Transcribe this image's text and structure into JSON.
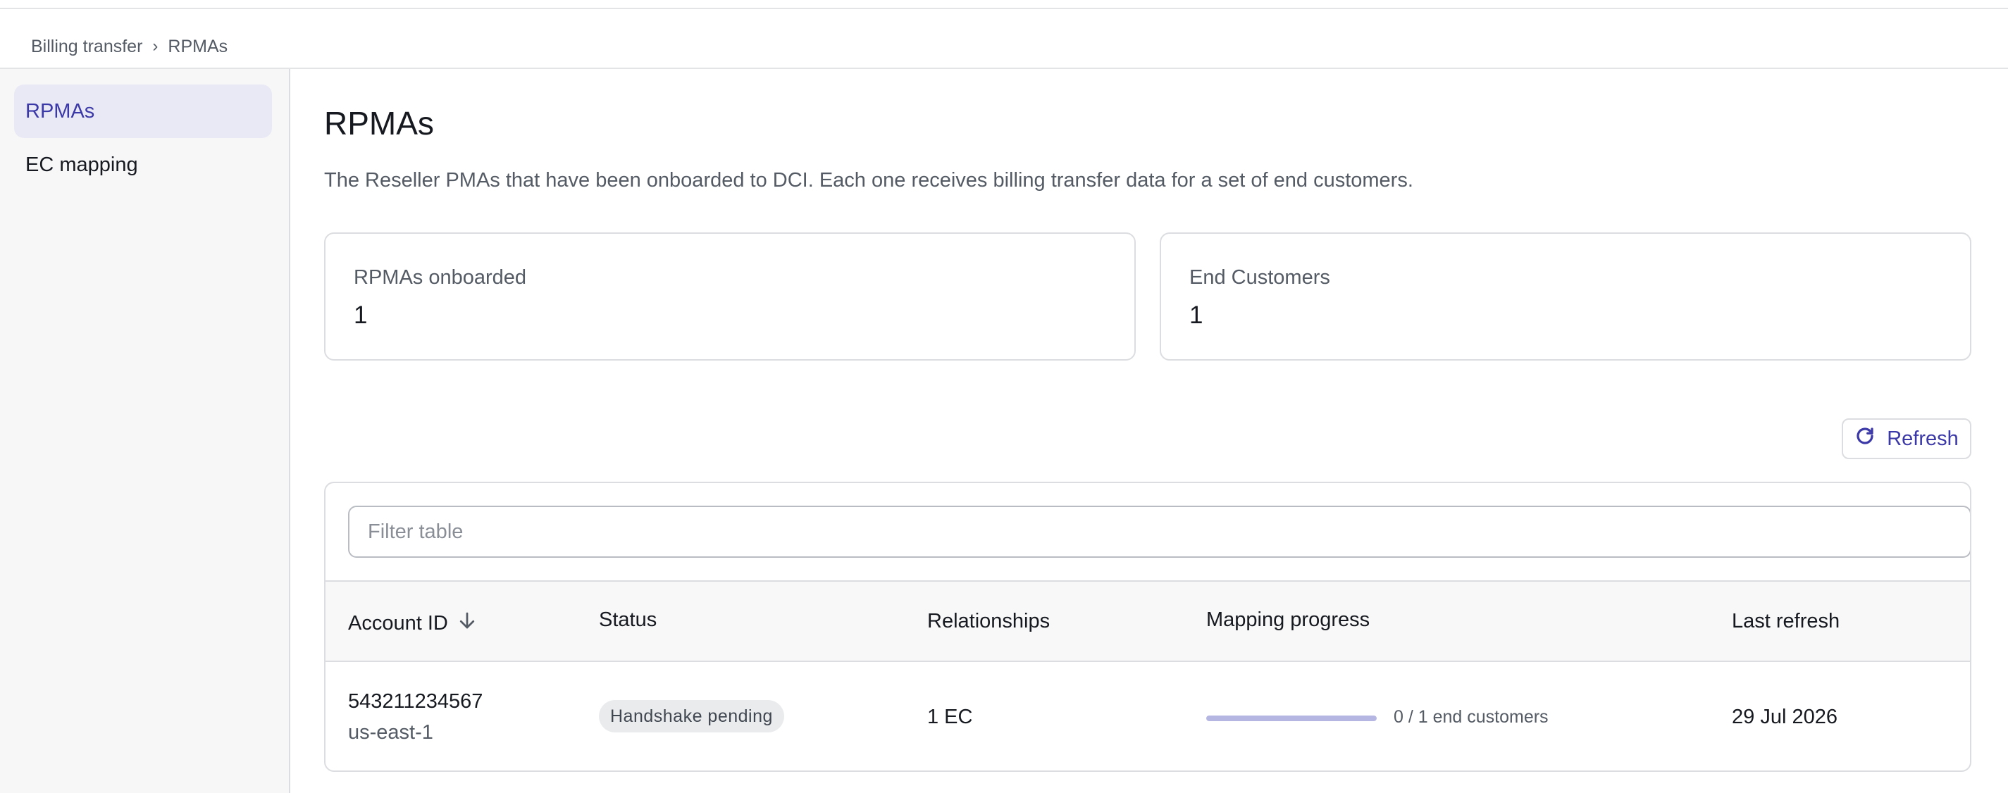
{
  "breadcrumb": {
    "parent": "Billing transfer",
    "separator": "›",
    "current": "RPMAs"
  },
  "sidebar": {
    "items": [
      {
        "label": "RPMAs",
        "active": true
      },
      {
        "label": "EC mapping",
        "active": false
      }
    ]
  },
  "page": {
    "title": "RPMAs",
    "description": "The Reseller PMAs that have been onboarded to DCI. Each one receives billing transfer data for a set of end customers."
  },
  "stats": [
    {
      "label": "RPMAs onboarded",
      "value": "1"
    },
    {
      "label": "End Customers",
      "value": "1"
    }
  ],
  "toolbar": {
    "refresh_label": "Refresh",
    "refresh_icon": "refresh-icon"
  },
  "table": {
    "filter_placeholder": "Filter table",
    "columns": [
      "Account ID",
      "Status",
      "Relationships",
      "Mapping progress",
      "Last refresh"
    ],
    "sort": {
      "column": "Account ID",
      "direction": "descending",
      "icon": "arrow-down-icon"
    },
    "rows": [
      {
        "account_id": "543211234567",
        "region": "us-east-1",
        "status": "Handshake pending",
        "relationships": "1 EC",
        "mapping_progress": {
          "mapped": 0,
          "total": 1,
          "text": "0 / 1 end customers"
        },
        "last_refresh": "29 Jul 2026"
      }
    ]
  },
  "colors": {
    "accent": "#3b38a8",
    "active_nav_bg": "#e9e9f5",
    "progress_track": "#b5b6e2",
    "badge_bg": "#e9ebed",
    "border": "#dcdde0"
  }
}
